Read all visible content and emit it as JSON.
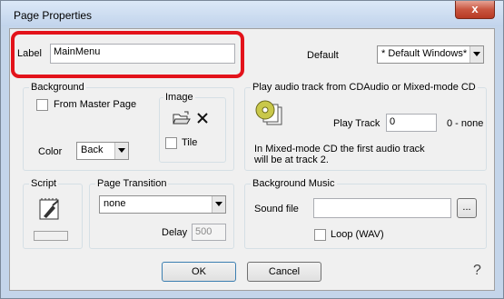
{
  "window": {
    "title": "Page Properties",
    "close_glyph": "x"
  },
  "label_field": {
    "label": "Label",
    "value": "MainMenu"
  },
  "default": {
    "label": "Default",
    "selected": "* Default Windows*"
  },
  "background": {
    "title": "Background",
    "from_master_page": "From Master Page",
    "color_label": "Color",
    "color_selected": "Back",
    "image_title": "Image",
    "tile_label": "Tile"
  },
  "audio": {
    "title": "Play audio track from CDAudio or Mixed-mode CD",
    "play_track_label": "Play Track",
    "play_track_value": "0",
    "play_track_hint": "0 - none",
    "info_line1": "In Mixed-mode CD the first audio track",
    "info_line2": "will be at track 2."
  },
  "script": {
    "title": "Script"
  },
  "transition": {
    "title": "Page Transition",
    "selected": "none",
    "delay_label": "Delay",
    "delay_value": "500"
  },
  "music": {
    "title": "Background Music",
    "sound_file_label": "Sound file",
    "sound_file_value": "",
    "browse_label": "...",
    "loop_label": "Loop (WAV)"
  },
  "buttons": {
    "ok": "OK",
    "cancel": "Cancel",
    "help_glyph": "?"
  },
  "colors": {
    "highlight": "#e3131b",
    "close_button": "#c9553f"
  },
  "icons": [
    "close-icon",
    "open-folder-icon",
    "delete-x-icon",
    "cd-audio-icon",
    "script-icon",
    "help-icon"
  ]
}
